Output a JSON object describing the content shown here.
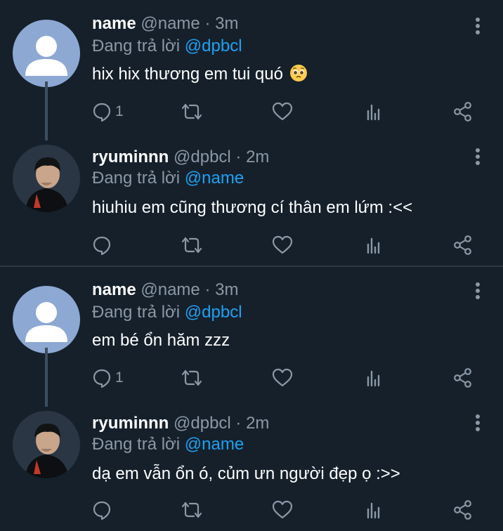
{
  "tweets": [
    {
      "name": "name",
      "handle": "@name · 3m",
      "reply_prefix": "Đang trả lời",
      "reply_to": "@dpbcl",
      "text": "hix hix thương em tui quó",
      "emoji": "pleading-face",
      "reply_count": "1",
      "avatar": "default-avatar"
    },
    {
      "name": "ryuminnn",
      "handle": "@dpbcl · 2m",
      "reply_prefix": "Đang trả lời",
      "reply_to": "@name",
      "text": "hiuhiu em cũng thương cí thân em lứm :<<",
      "reply_count": "",
      "avatar": "photo-avatar"
    },
    {
      "name": "name",
      "handle": "@name · 3m",
      "reply_prefix": "Đang trả lời",
      "reply_to": "@dpbcl",
      "text": "em bé ổn hăm zzz",
      "reply_count": "1",
      "avatar": "default-avatar"
    },
    {
      "name": "ryuminnn",
      "handle": "@dpbcl · 2m",
      "reply_prefix": "Đang trả lời",
      "reply_to": "@name",
      "text": "dạ em vẫn ổn ó, củm ưn người đẹp ọ :>>",
      "reply_count": "",
      "avatar": "photo-avatar"
    }
  ],
  "colors": {
    "background": "#15202b",
    "secondary_text": "#8b98a5",
    "mention": "#1da1f2",
    "thread_line": "#3d4f5f"
  }
}
